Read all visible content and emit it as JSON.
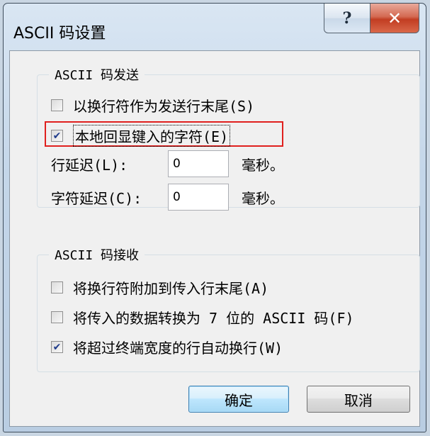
{
  "window": {
    "title": "ASCII 码设置",
    "help_glyph": "?",
    "close_glyph": "✕"
  },
  "send_group": {
    "legend": "ASCII 码发送",
    "append_line_feeds": {
      "label": "以换行符作为发送行末尾(S)",
      "checked": false
    },
    "echo_typed": {
      "label": "本地回显键入的字符(E)",
      "checked": true
    },
    "line_delay": {
      "label": "行延迟(L):",
      "value": "0",
      "unit": "毫秒。"
    },
    "char_delay": {
      "label": "字符延迟(C):",
      "value": "0",
      "unit": "毫秒。"
    }
  },
  "receive_group": {
    "legend": "ASCII 码接收",
    "append_line_feeds_incoming": {
      "label": "将换行符附加到传入行末尾(A)",
      "checked": false
    },
    "force_7bit": {
      "label": "将传入的数据转换为 7 位的 ASCII 码(F)",
      "checked": false
    },
    "wrap_lines": {
      "label": "将超过终端宽度的行自动换行(W)",
      "checked": true
    }
  },
  "buttons": {
    "ok": "确定",
    "cancel": "取消"
  },
  "colors": {
    "highlight_box": "#e0201e",
    "close_button": "#c23d22",
    "default_button_border": "#3c7fb1"
  }
}
